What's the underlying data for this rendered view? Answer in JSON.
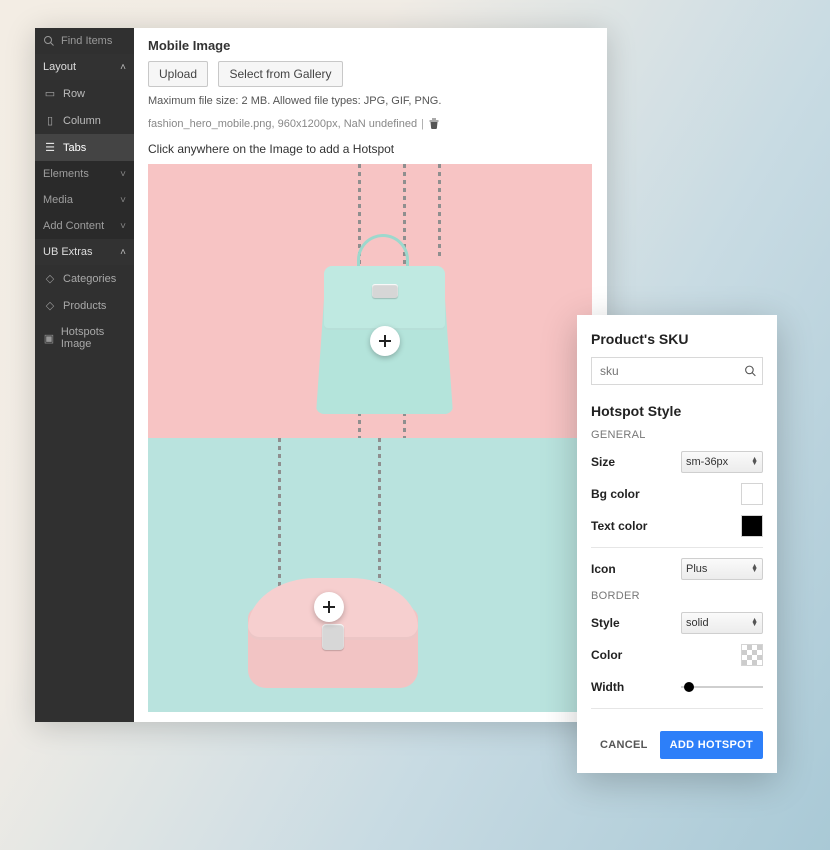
{
  "sidebar": {
    "search_placeholder": "Find Items",
    "panels": {
      "layout": {
        "label": "Layout",
        "open": true,
        "items": [
          "Row",
          "Column",
          "Tabs"
        ]
      },
      "elements": {
        "label": "Elements",
        "open": false
      },
      "media": {
        "label": "Media",
        "open": false
      },
      "add_content": {
        "label": "Add Content",
        "open": false
      },
      "ub_extras": {
        "label": "UB Extras",
        "open": true,
        "items": [
          "Categories",
          "Products",
          "Hotspots Image"
        ]
      }
    }
  },
  "main": {
    "section_title": "Mobile Image",
    "upload_label": "Upload",
    "gallery_label": "Select from Gallery",
    "hint": "Maximum file size: 2 MB. Allowed file types: JPG, GIF, PNG.",
    "file_name": "fashion_hero_mobile.png, 960x1200px, NaN undefined",
    "click_hint": "Click anywhere on the Image to add a Hotspot"
  },
  "panel": {
    "sku_heading": "Product's SKU",
    "sku_placeholder": "sku",
    "style_heading": "Hotspot Style",
    "general_label": "GENERAL",
    "size_label": "Size",
    "size_value": "sm-36px",
    "bgcolor_label": "Bg color",
    "textcolor_label": "Text color",
    "icon_label": "Icon",
    "icon_value": "Plus",
    "border_label": "BORDER",
    "style_label": "Style",
    "style_value": "solid",
    "color_label": "Color",
    "width_label": "Width",
    "cancel_label": "CANCEL",
    "submit_label": "ADD HOTSPOT"
  }
}
